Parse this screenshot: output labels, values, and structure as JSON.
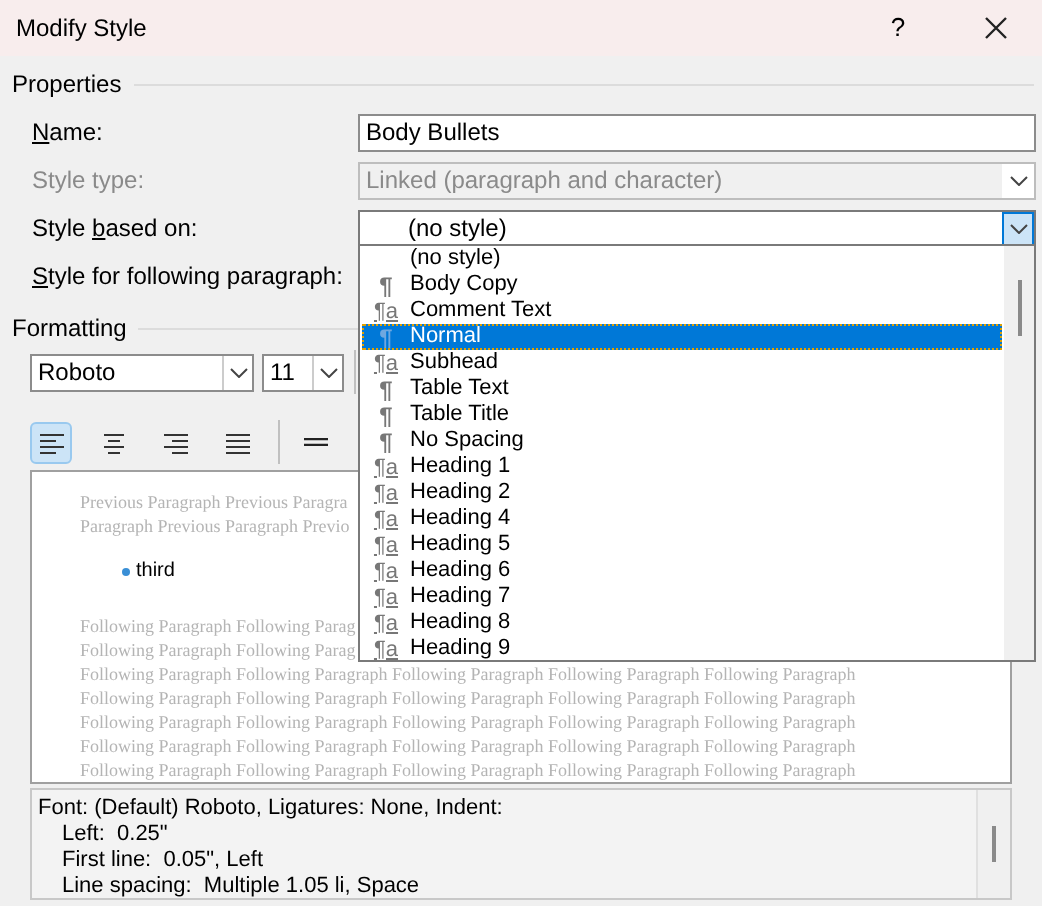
{
  "window": {
    "title": "Modify Style",
    "help": "?"
  },
  "properties": {
    "heading": "Properties",
    "rows": [
      {
        "label": {
          "key": "N",
          "after": "ame:"
        },
        "kind": "text",
        "value": "Body Bullets",
        "disabled": false
      },
      {
        "label": {
          "before": "Style type:"
        },
        "kind": "combo",
        "value": "Linked (paragraph and character)",
        "disabled": true
      },
      {
        "label": {
          "before": "Style ",
          "key": "b",
          "after": "ased on:"
        },
        "kind": "combo",
        "value": "(no style)",
        "disabled": false,
        "focused": true
      },
      {
        "label": {
          "key": "S",
          "after": "tyle for following paragraph:"
        },
        "kind": "hidden",
        "disabled": false
      }
    ]
  },
  "style_list": [
    {
      "label": "(no style)",
      "selected": false
    },
    {
      "icon": "¶",
      "kind": "paragraph",
      "label": "Body Copy",
      "selected": false
    },
    {
      "icon": "¶a",
      "kind": "linked",
      "label": "Comment Text",
      "selected": false
    },
    {
      "icon": "¶",
      "kind": "paragraph",
      "label": "Normal",
      "selected": true
    },
    {
      "icon": "¶a",
      "kind": "linked",
      "label": "Subhead",
      "selected": false
    },
    {
      "icon": "¶",
      "kind": "paragraph",
      "label": "Table Text",
      "selected": false
    },
    {
      "icon": "¶",
      "kind": "paragraph",
      "label": "Table Title",
      "selected": false
    },
    {
      "icon": "¶",
      "kind": "paragraph",
      "label": "No Spacing",
      "selected": false
    },
    {
      "icon": "¶a",
      "kind": "linked",
      "label": "Heading 1",
      "selected": false
    },
    {
      "icon": "¶a",
      "kind": "linked",
      "label": "Heading 2",
      "selected": false
    },
    {
      "icon": "¶a",
      "kind": "linked",
      "label": "Heading 4",
      "selected": false
    },
    {
      "icon": "¶a",
      "kind": "linked",
      "label": "Heading 5",
      "selected": false
    },
    {
      "icon": "¶a",
      "kind": "linked",
      "label": "Heading 6",
      "selected": false
    },
    {
      "icon": "¶a",
      "kind": "linked",
      "label": "Heading 7",
      "selected": false
    },
    {
      "icon": "¶a",
      "kind": "linked",
      "label": "Heading 8",
      "selected": false
    },
    {
      "icon": "¶a",
      "kind": "linked",
      "label": "Heading 9",
      "selected": false
    }
  ],
  "formatting": {
    "heading": "Formatting",
    "font": "Roboto",
    "size": "11",
    "alignment": [
      {
        "kind": "left",
        "selected": true
      },
      {
        "kind": "center",
        "selected": false
      },
      {
        "kind": "right",
        "selected": false
      },
      {
        "kind": "justify",
        "selected": false
      }
    ]
  },
  "preview": {
    "previous": [
      "Previous Paragraph Previous Paragra",
      "Paragraph Previous Paragraph Previo"
    ],
    "bullet_text": "third",
    "following": [
      "Following Paragraph Following Parag",
      "Following Paragraph Following Parag",
      "Following Paragraph Following Paragraph Following Paragraph Following Paragraph Following Paragraph",
      "Following Paragraph Following Paragraph Following Paragraph Following Paragraph Following Paragraph",
      "Following Paragraph Following Paragraph Following Paragraph Following Paragraph Following Paragraph",
      "Following Paragraph Following Paragraph Following Paragraph Following Paragraph Following Paragraph",
      "Following Paragraph Following Paragraph Following Paragraph Following Paragraph Following Paragraph"
    ]
  },
  "description": [
    "Font: (Default) Roboto, Ligatures: None, Indent:",
    "Left:  0.25\"",
    "First line:  0.05\", Left",
    "Line spacing:  Multiple 1.05 li, Space"
  ]
}
